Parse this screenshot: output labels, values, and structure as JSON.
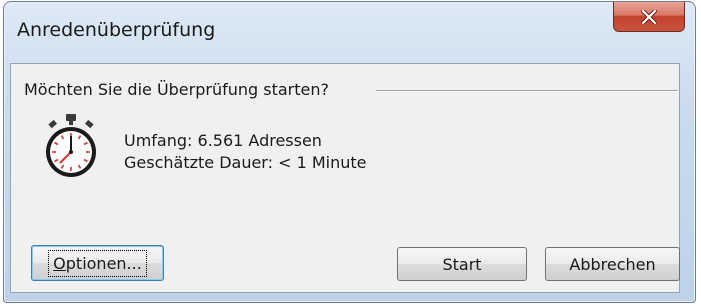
{
  "window": {
    "title": "Anredenüberprüfung",
    "close_icon": "close-icon"
  },
  "prompt": {
    "question": "Möchten Sie die Überprüfung starten?"
  },
  "info": {
    "icon": "stopwatch-icon",
    "scope": "Umfang: 6.561 Adressen",
    "duration": "Geschätzte Dauer: < 1 Minute"
  },
  "buttons": {
    "options_accel": "O",
    "options_rest": "ptionen...",
    "start": "Start",
    "cancel": "Abbrechen"
  },
  "colors": {
    "frame": "#c9daed",
    "close_button": "#c9543e",
    "client": "#f0f0f0"
  }
}
